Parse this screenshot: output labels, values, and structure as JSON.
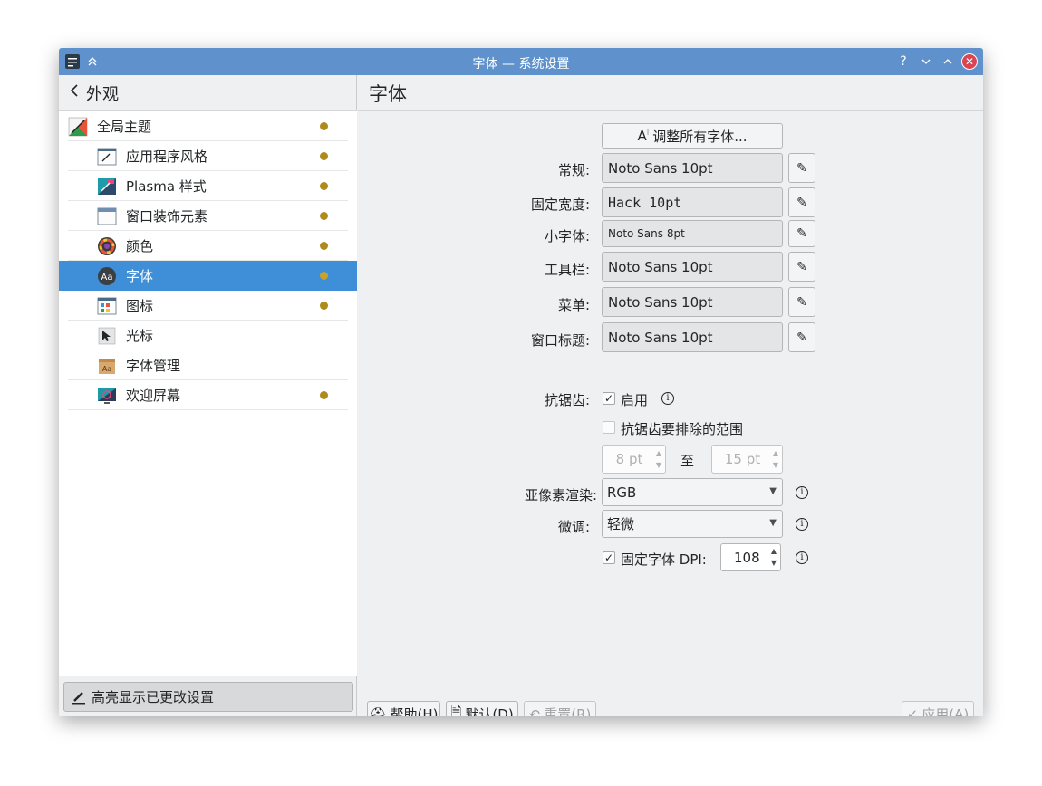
{
  "window": {
    "title": "字体 — 系统设置",
    "titlebar_buttons": [
      "help-icon",
      "minimize-icon",
      "maximize-icon",
      "close-icon"
    ]
  },
  "sidebar": {
    "back_label": "外观",
    "items": [
      {
        "label": "全局主题",
        "icon": "global-theme-icon",
        "changed": true
      },
      {
        "label": "应用程序风格",
        "icon": "app-style-icon",
        "changed": true
      },
      {
        "label": "Plasma 样式",
        "icon": "plasma-style-icon",
        "changed": true
      },
      {
        "label": "窗口装饰元素",
        "icon": "window-decoration-icon",
        "changed": true
      },
      {
        "label": "颜色",
        "icon": "colors-icon",
        "changed": true
      },
      {
        "label": "字体",
        "icon": "fonts-icon",
        "changed": true,
        "selected": true
      },
      {
        "label": "图标",
        "icon": "icons-icon",
        "changed": true
      },
      {
        "label": "光标",
        "icon": "cursor-icon",
        "changed": false
      },
      {
        "label": "字体管理",
        "icon": "font-management-icon",
        "changed": false
      },
      {
        "label": "欢迎屏幕",
        "icon": "splash-screen-icon",
        "changed": true
      }
    ],
    "highlight_button": "高亮显示已更改设置"
  },
  "main": {
    "title": "字体",
    "adjust_all_button": "调整所有字体...",
    "fonts": [
      {
        "label": "常规:",
        "value": "Noto Sans 10pt"
      },
      {
        "label": "固定宽度:",
        "value": "Hack 10pt"
      },
      {
        "label": "小字体:",
        "value": "Noto Sans 8pt"
      },
      {
        "label": "工具栏:",
        "value": "Noto Sans 10pt"
      },
      {
        "label": "菜单:",
        "value": "Noto Sans 10pt"
      },
      {
        "label": "窗口标题:",
        "value": "Noto Sans 10pt"
      }
    ],
    "antialiasing": {
      "label": "抗锯齿:",
      "enable_label": "启用",
      "enabled": true,
      "exclude_label": "抗锯齿要排除的范围",
      "exclude_enabled": false,
      "range_from": "8 pt",
      "range_to_label": "至",
      "range_to": "15 pt"
    },
    "subpixel": {
      "label": "亚像素渲染:",
      "value": "RGB"
    },
    "hinting": {
      "label": "微调:",
      "value": "轻微"
    },
    "dpi": {
      "label": "固定字体 DPI:",
      "enabled": true,
      "value": "108"
    }
  },
  "footer": {
    "help_label": "帮助(",
    "help_key": "H",
    "defaults_label": "默认(",
    "defaults_key": "D",
    "reset_label": "重置(",
    "reset_key": "R",
    "apply_label": "应用(",
    "apply_key": "A",
    "close_paren": ")"
  },
  "colors": {
    "titlebar": "#5f92cc",
    "selection": "#3e8ed8",
    "changed_dot": "#b08a1a",
    "close_button": "#da4453"
  }
}
